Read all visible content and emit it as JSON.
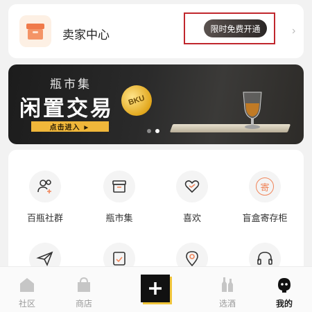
{
  "seller": {
    "title": "卖家中心",
    "open_button": "限时免费开通",
    "chevron": "›"
  },
  "banner": {
    "subtitle": "瓶市集",
    "title": "闲置交易",
    "cta": "点击进入 ►",
    "coin_text": "BKU",
    "dots_total": 2,
    "active_dot": 2
  },
  "features": {
    "row1": [
      {
        "label": "百瓶社群",
        "icon": "community-icon"
      },
      {
        "label": "瓶市集",
        "icon": "market-box-icon"
      },
      {
        "label": "喜欢",
        "icon": "heart-icon"
      },
      {
        "label": "盲盒寄存柜",
        "icon": "storage-icon",
        "glyph": "寄"
      }
    ],
    "row2": [
      {
        "icon": "send-icon"
      },
      {
        "icon": "order-icon"
      },
      {
        "icon": "location-icon"
      },
      {
        "icon": "headset-icon"
      }
    ]
  },
  "tabbar": {
    "items": [
      {
        "label": "社区",
        "icon": "community-tab-icon"
      },
      {
        "label": "商店",
        "icon": "shop-tab-icon"
      },
      {
        "label": "选酒",
        "icon": "bottles-tab-icon"
      },
      {
        "label": "我的",
        "icon": "profile-tab-icon",
        "active": true
      }
    ]
  },
  "colors": {
    "accent": "#f0b73a",
    "highlight_box": "#c0262c",
    "seller_logo": "#f0855a"
  }
}
